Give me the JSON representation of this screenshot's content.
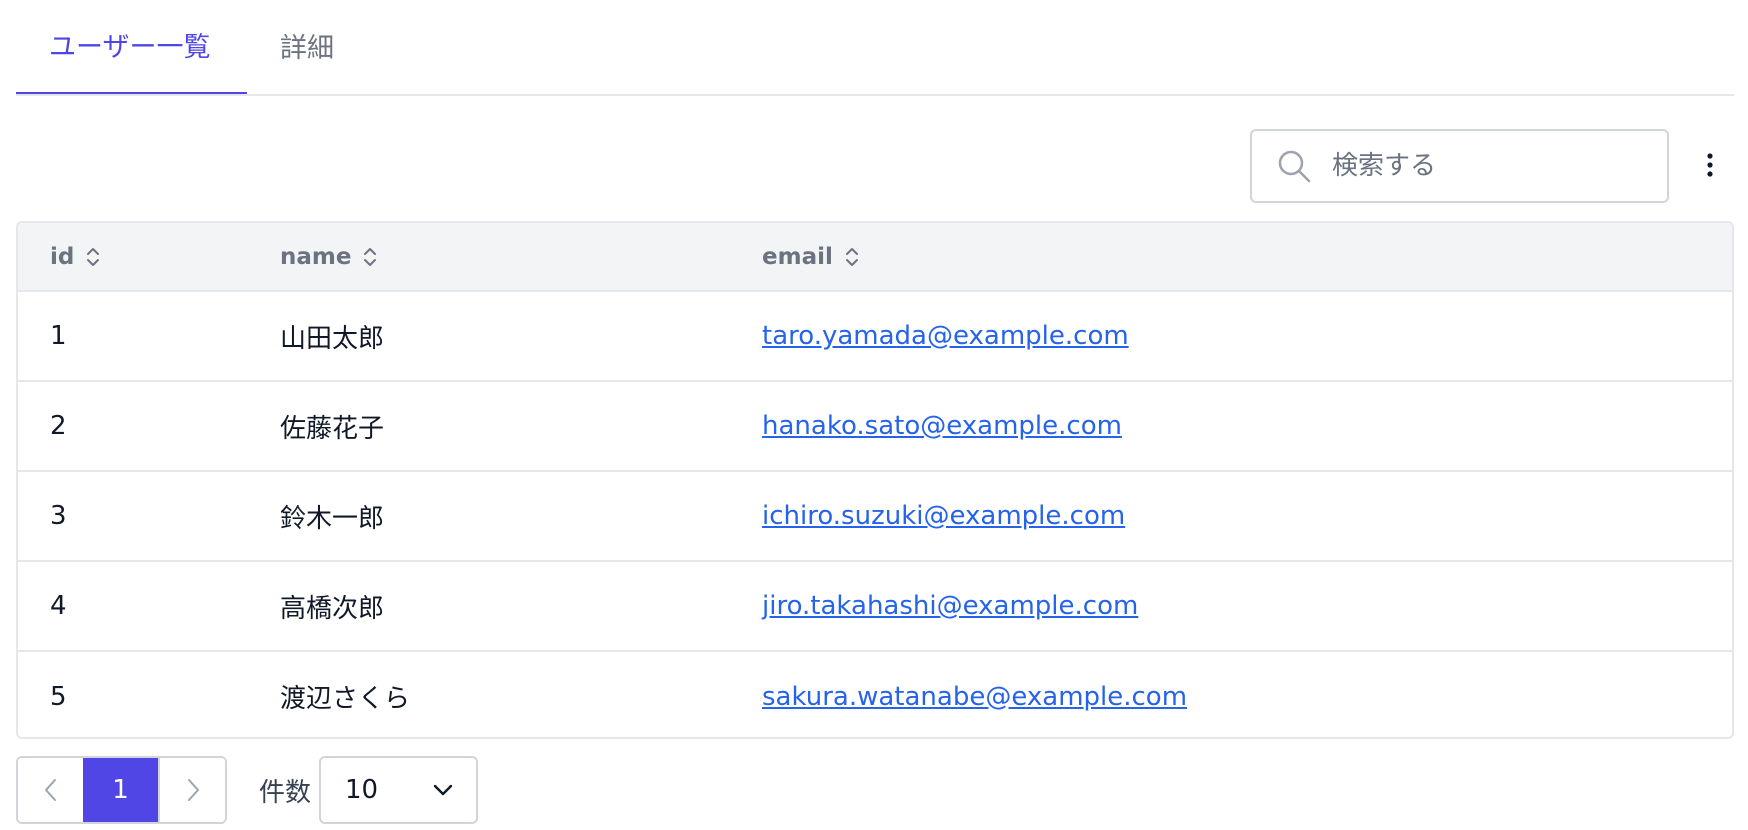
{
  "tabs": [
    {
      "label": "ユーザー一覧",
      "active": true
    },
    {
      "label": "詳細",
      "active": false
    }
  ],
  "toolbar": {
    "search_placeholder": "検索する",
    "search_value": "",
    "search_icon": "search-icon",
    "menu_icon": "more-vertical-icon"
  },
  "table": {
    "columns": [
      {
        "key": "id",
        "label": "id",
        "sortable": true
      },
      {
        "key": "name",
        "label": "name",
        "sortable": true
      },
      {
        "key": "email",
        "label": "email",
        "sortable": true
      }
    ],
    "rows": [
      {
        "id": "1",
        "name": "山田太郎",
        "email": "taro.yamada@example.com"
      },
      {
        "id": "2",
        "name": "佐藤花子",
        "email": "hanako.sato@example.com"
      },
      {
        "id": "3",
        "name": "鈴木一郎",
        "email": "ichiro.suzuki@example.com"
      },
      {
        "id": "4",
        "name": "高橋次郎",
        "email": "jiro.takahashi@example.com"
      },
      {
        "id": "5",
        "name": "渡辺さくら",
        "email": "sakura.watanabe@example.com"
      }
    ]
  },
  "pagination": {
    "current_page": "1",
    "prev_icon": "chevron-left-icon",
    "next_icon": "chevron-right-icon",
    "count_label": "件数",
    "page_size": "10",
    "page_size_icon": "chevron-down-icon"
  },
  "colors": {
    "accent": "#4f46e5",
    "link": "#2563eb",
    "border": "#e5e7eb",
    "header_bg": "#f3f4f6",
    "muted_text": "#6b7280"
  }
}
